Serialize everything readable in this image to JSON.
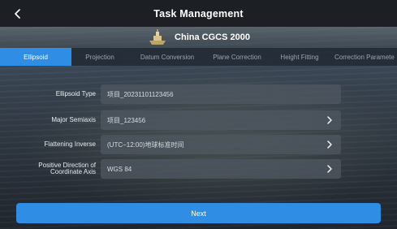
{
  "header": {
    "title": "Task Management",
    "back_icon": "chevron-left-icon"
  },
  "coordinate_system": {
    "name": "China CGCS 2000",
    "icon": "boat-icon"
  },
  "tabs": [
    {
      "label": "Ellipsoid",
      "active": true
    },
    {
      "label": "Projection",
      "active": false
    },
    {
      "label": "Datum Conversion",
      "active": false
    },
    {
      "label": "Plane Correction",
      "active": false
    },
    {
      "label": "Height Fitting",
      "active": false
    },
    {
      "label": "Correction Paramete",
      "active": false
    }
  ],
  "form": {
    "ellipsoid_type": {
      "label": "Ellipsoid Type",
      "value": "项目_20231101123456"
    },
    "major_semiaxis": {
      "label": "Major Semiaxis",
      "value": "项目_123456"
    },
    "flattening_inverse": {
      "label": "Flattening Inverse",
      "value": "(UTC−12:00)地球标准时间"
    },
    "positive_direction": {
      "label_line1": "Positive Direction of",
      "label_line2": "Coordinate Axis",
      "value": "WGS 84"
    }
  },
  "footer": {
    "next_label": "Next"
  },
  "colors": {
    "accent": "#2f8de4",
    "titlebar": "#1c1e22"
  }
}
